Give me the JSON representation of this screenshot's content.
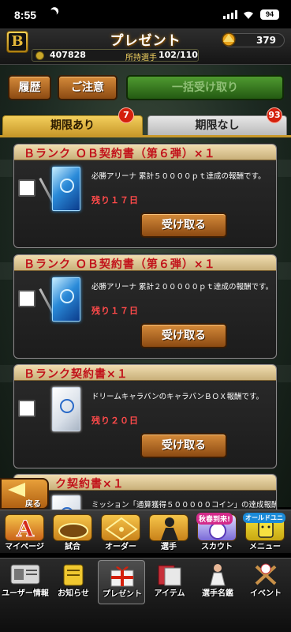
{
  "status_bar": {
    "time": "8:55",
    "battery": "94"
  },
  "header": {
    "title": "プレゼント",
    "logo_letter": "B",
    "coins": "379",
    "points": "407828",
    "players_label": "所持選手",
    "players_count": "102/110"
  },
  "actions": {
    "history_label": "履歴",
    "notice_label": "ご注意",
    "receive_all_label": "一括受け取り"
  },
  "tabs": [
    {
      "label": "期限あり",
      "badge": "7",
      "active": true
    },
    {
      "label": "期限なし",
      "badge": "93",
      "active": false
    }
  ],
  "cards": [
    {
      "title": "Ｂランク ＯＢ契約書（第６弾）×１",
      "description": "必勝アリーナ 累計５００００ｐｔ達成の報酬です。",
      "remaining": "残り１７日",
      "button": "受け取る",
      "icon": "blue-contract-icon"
    },
    {
      "title": "Ｂランク ＯＢ契約書（第６弾）×１",
      "description": "必勝アリーナ 累計２０００００ｐｔ達成の報酬です。",
      "remaining": "残り１７日",
      "button": "受け取る",
      "icon": "blue-contract-icon"
    },
    {
      "title": "Ｂランク契約書×１",
      "description": "ドリームキャラバンのキャラバンＢＯＸ報酬です。",
      "remaining": "残り２０日",
      "button": "受け取る",
      "icon": "white-contract-icon"
    },
    {
      "title": "ク契約書×１",
      "description": "ミッション「通算獲得５０００００コイン」の達成報酬",
      "remaining": "",
      "button": "",
      "icon": "white-contract-icon"
    }
  ],
  "back": {
    "label": "戻る"
  },
  "nav_primary": [
    {
      "label": "マイページ",
      "icon": "home-a-icon"
    },
    {
      "label": "試合",
      "icon": "stadium-icon"
    },
    {
      "label": "オーダー",
      "icon": "order-icon"
    },
    {
      "label": "選手",
      "icon": "player-icon"
    },
    {
      "label": "スカウト",
      "icon": "scout-icon",
      "badge": "秋春到来!"
    },
    {
      "label": "メニュー",
      "icon": "menu-icon",
      "badge": "オールドユニ"
    }
  ],
  "nav_secondary": [
    {
      "label": "ユーザー情報",
      "icon": "user-info-icon"
    },
    {
      "label": "お知らせ",
      "icon": "news-icon"
    },
    {
      "label": "プレゼント",
      "icon": "gift-icon",
      "active": true
    },
    {
      "label": "アイテム",
      "icon": "item-icon"
    },
    {
      "label": "選手名鑑",
      "icon": "player-book-icon"
    },
    {
      "label": "イベント",
      "icon": "event-icon"
    }
  ],
  "colors": {
    "accent_gold": "#c8982a",
    "button_brown": "#b06a22",
    "button_green": "#3a7a20",
    "title_red": "#c1121a",
    "remaining_red": "#ff4a4a",
    "badge_red": "#d4200c"
  }
}
